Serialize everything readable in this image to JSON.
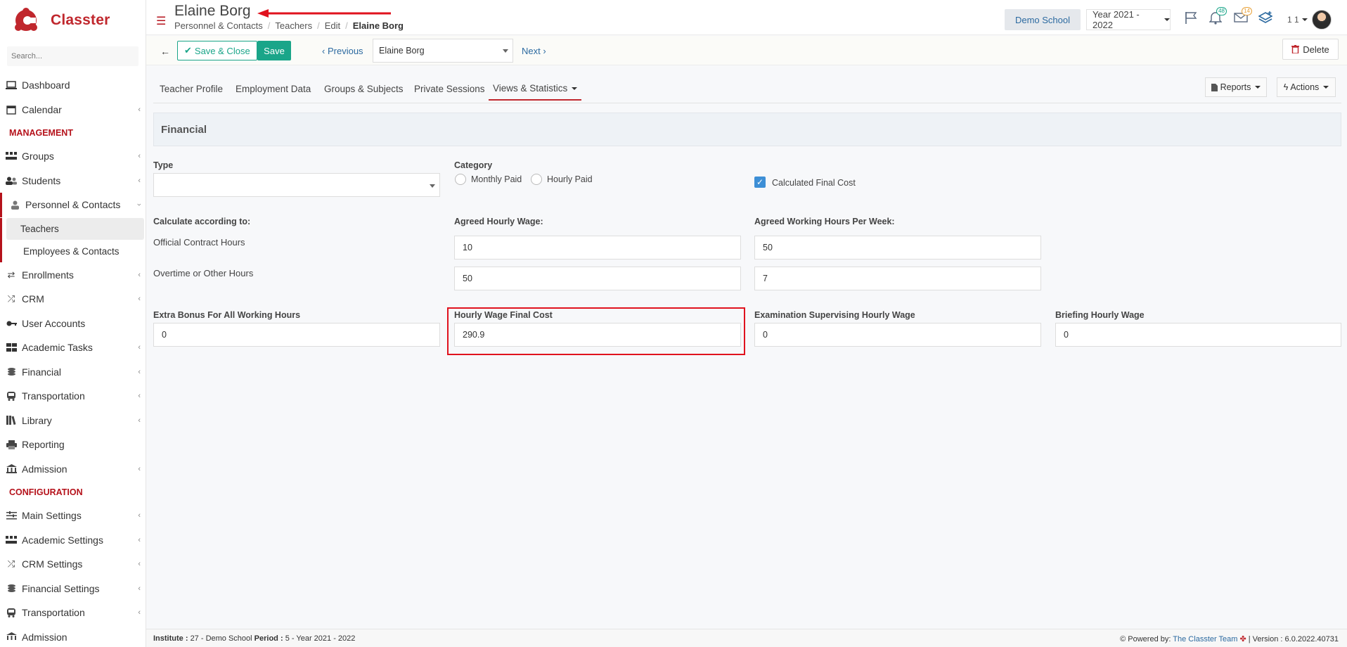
{
  "app": {
    "brand": "Classter"
  },
  "sidebar": {
    "search_placeholder": "Search...",
    "items": [
      {
        "label": "Dashboard"
      },
      {
        "label": "Calendar"
      },
      {
        "label": "Groups"
      },
      {
        "label": "Students"
      },
      {
        "label": "Personnel & Contacts"
      },
      {
        "label": "Enrollments"
      },
      {
        "label": "CRM"
      },
      {
        "label": "User Accounts"
      },
      {
        "label": "Academic Tasks"
      },
      {
        "label": "Financial"
      },
      {
        "label": "Transportation"
      },
      {
        "label": "Library"
      },
      {
        "label": "Reporting"
      },
      {
        "label": "Admission"
      }
    ],
    "sub_items": [
      {
        "label": "Teachers"
      },
      {
        "label": "Employees & Contacts"
      }
    ],
    "config_items": [
      {
        "label": "Main Settings"
      },
      {
        "label": "Academic Settings"
      },
      {
        "label": "CRM Settings"
      },
      {
        "label": "Financial Settings"
      },
      {
        "label": "Transportation"
      },
      {
        "label": "Admission"
      }
    ],
    "section_management": "MANAGEMENT",
    "section_configuration": "CONFIGURATION"
  },
  "header": {
    "title": "Elaine Borg",
    "breadcrumb": [
      "Personnel & Contacts",
      "Teachers",
      "Edit",
      "Elaine Borg"
    ],
    "school": "Demo School",
    "year": "Year 2021 - 2022",
    "notifications_count": "48",
    "messages_count": "14",
    "user_label": "1 1"
  },
  "toolbar": {
    "save_close_label": "Save & Close",
    "save_label": "Save",
    "previous_label": "Previous",
    "person_value": "Elaine Borg",
    "next_label": "Next",
    "delete_label": "Delete"
  },
  "tabs": {
    "items": [
      "Teacher Profile",
      "Employment Data",
      "Groups & Subjects",
      "Private Sessions",
      "Views & Statistics"
    ],
    "reports_label": "Reports",
    "actions_label": "Actions"
  },
  "financial": {
    "heading": "Financial",
    "type_label": "Type",
    "type_value": "",
    "category_label": "Category",
    "category_options": [
      "Monthly Paid",
      "Hourly Paid"
    ],
    "calculated_final_cost_label": "Calculated Final Cost",
    "calculate_according_label": "Calculate according to:",
    "official_hours_label": "Official Contract Hours",
    "overtime_label": "Overtime or Other Hours",
    "agreed_hourly_wage_label": "Agreed Hourly Wage:",
    "agreed_hourly_wage_official": "10",
    "agreed_hourly_wage_overtime": "50",
    "agreed_hours_week_label": "Agreed Working Hours Per Week:",
    "agreed_hours_week_official": "50",
    "agreed_hours_week_overtime": "7",
    "extra_bonus_label": "Extra Bonus For All Working Hours",
    "extra_bonus_value": "0",
    "hourly_final_cost_label": "Hourly Wage Final Cost",
    "hourly_final_cost_value": "290.9",
    "exam_supervising_label": "Examination Supervising Hourly Wage",
    "exam_supervising_value": "0",
    "briefing_label": "Briefing Hourly Wage",
    "briefing_value": "0"
  },
  "footer": {
    "institute_label": "Institute :",
    "institute_value": "27 - Demo School",
    "period_label": "Period :",
    "period_value": "5 - Year 2021 - 2022",
    "powered_label": "Powered by:",
    "powered_link": "The Classter Team",
    "version": "| Version : 6.0.2022.40731"
  },
  "colors": {
    "brand": "#c0272d",
    "accent": "#1aa589",
    "link": "#2c6aa0",
    "highlight": "#e0121e"
  }
}
